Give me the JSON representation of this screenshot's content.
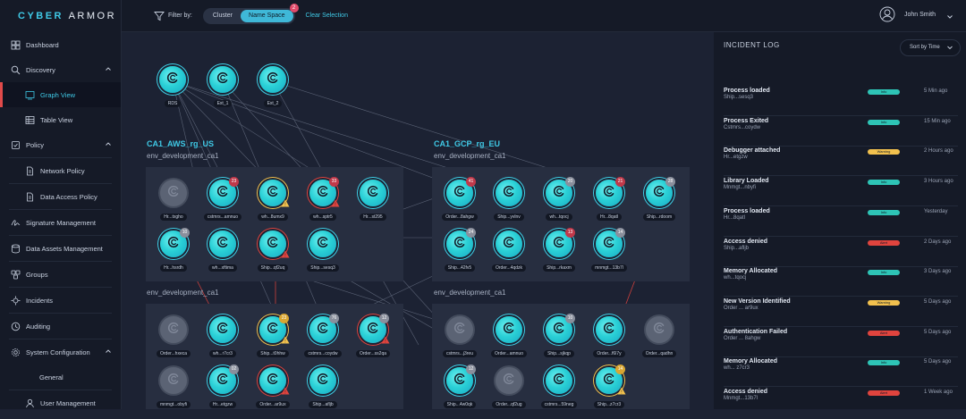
{
  "brand": {
    "cyber": "CYBER",
    "armor": "ARMOR"
  },
  "sidebar": {
    "items": [
      {
        "label": "Dashboard",
        "icon": "dashboard-icon"
      },
      {
        "label": "Discovery",
        "icon": "search-icon"
      },
      {
        "label": "Graph View",
        "icon": "graph-view-icon"
      },
      {
        "label": "Table View",
        "icon": "table-icon"
      },
      {
        "label": "Policy",
        "icon": "policy-icon"
      },
      {
        "label": "Network Policy",
        "icon": "document-icon"
      },
      {
        "label": "Data Access Policy",
        "icon": "document-icon"
      },
      {
        "label": "Signature Management",
        "icon": "signature-icon"
      },
      {
        "label": "Data Assets Management",
        "icon": "database-icon"
      },
      {
        "label": "Groups",
        "icon": "groups-icon"
      },
      {
        "label": "Incidents",
        "icon": "incidents-icon"
      },
      {
        "label": "Auditing",
        "icon": "auditing-icon"
      },
      {
        "label": "System Configuration",
        "icon": "settings-icon"
      },
      {
        "label": "General",
        "icon": ""
      },
      {
        "label": "User Management",
        "icon": "user-icon"
      }
    ]
  },
  "topbar": {
    "filter_label": "Filter by:",
    "options": [
      "Cluster",
      "Name Space"
    ],
    "active_option": "Name Space",
    "badge": "2",
    "clear": "Clear Selection",
    "user": "John Smith"
  },
  "graph": {
    "top_nodes": [
      "RDS",
      "Ext_1",
      "Ext_2"
    ],
    "clusters": [
      {
        "name": "CA1_AWS_rg_US",
        "envs": [
          {
            "name": "env_development_ca1",
            "nodes": [
              {
                "label": "Hr...txgho",
                "count": "",
                "alert": ""
              },
              {
                "label": "cstmrs...amnuo",
                "count": "23",
                "alert": ""
              },
              {
                "label": "wh...8umx9",
                "count": "",
                "alert": "warning"
              },
              {
                "label": "wh...sptr5",
                "count": "33",
                "alert": "alert"
              },
              {
                "label": "Hr...st295",
                "count": "",
                "alert": ""
              },
              {
                "label": "Hr...hsrdh",
                "count": "10",
                "alert": ""
              },
              {
                "label": "wh...xftima",
                "count": "",
                "alert": ""
              },
              {
                "label": "Ship...qf2uq",
                "count": "",
                "alert": "alert"
              },
              {
                "label": "Ship...sesq3",
                "count": "",
                "alert": ""
              }
            ]
          },
          {
            "name": "env_development_ca1",
            "nodes": [
              {
                "label": "Order...hxeca",
                "count": "",
                "alert": ""
              },
              {
                "label": "wh...r7cr3",
                "count": "",
                "alert": ""
              },
              {
                "label": "Ship...t0hhw",
                "count": "23",
                "alert": "warning"
              },
              {
                "label": "cstmrs...coydw",
                "count": "76",
                "alert": ""
              },
              {
                "label": "Order...ss2qa",
                "count": "12",
                "alert": "alert"
              },
              {
                "label": "mnmgt...obyfi",
                "count": "",
                "alert": ""
              },
              {
                "label": "Hr...etgzw",
                "count": "02",
                "alert": ""
              },
              {
                "label": "Order...ar9ux",
                "count": "",
                "alert": "alert"
              },
              {
                "label": "Ship...afljb",
                "count": "",
                "alert": ""
              }
            ]
          }
        ]
      },
      {
        "name": "CA1_GCP_rg_EU",
        "envs": [
          {
            "name": "env_development_ca1",
            "nodes": [
              {
                "label": "Order...8ahgw",
                "count": "41",
                "alert": ""
              },
              {
                "label": "Ship...yvlnv",
                "count": "",
                "alert": ""
              },
              {
                "label": "wh...tqocj",
                "count": "20",
                "alert": ""
              },
              {
                "label": "Hr...8qatl",
                "count": "21",
                "alert": ""
              },
              {
                "label": "Ship...rdoom",
                "count": "28",
                "alert": ""
              },
              {
                "label": "Ship...42fv5",
                "count": "24",
                "alert": ""
              },
              {
                "label": "Order...4qdzk",
                "count": "",
                "alert": ""
              },
              {
                "label": "Ship...rkaxm",
                "count": "13",
                "alert": ""
              },
              {
                "label": "mnmgt...13b7l",
                "count": "14",
                "alert": ""
              }
            ]
          },
          {
            "name": "env_development_ca1",
            "nodes": [
              {
                "label": "cstmrs...j3reu",
                "count": "",
                "alert": ""
              },
              {
                "label": "Order...amnuo",
                "count": "",
                "alert": ""
              },
              {
                "label": "Ship...sjkqp",
                "count": "10",
                "alert": ""
              },
              {
                "label": "Order...f6l7y",
                "count": "",
                "alert": ""
              },
              {
                "label": "Order...qadhn",
                "count": "",
                "alert": ""
              },
              {
                "label": "Ship...4w0qk",
                "count": "12",
                "alert": ""
              },
              {
                "label": "Order...qf2ug",
                "count": "",
                "alert": ""
              },
              {
                "label": "cstmrs...59neg",
                "count": "",
                "alert": ""
              },
              {
                "label": "Ship...z7cr3",
                "count": "14",
                "alert": "warning"
              }
            ]
          }
        ]
      }
    ]
  },
  "incident_log": {
    "title": "INCIDENT LOG",
    "sort_label": "Sort by Time",
    "rows": [
      {
        "title": "Process loaded",
        "sub": "Ship...sesq3",
        "level": "Info",
        "time": "5 Min ago"
      },
      {
        "title": "Process Exited",
        "sub": "Cstmrs...coydw",
        "level": "Info",
        "time": "15 Min ago"
      },
      {
        "title": "Debugger attached",
        "sub": "Hr...etgzw",
        "level": "Warning",
        "time": "2 Hours ago"
      },
      {
        "title": "Library Loaded",
        "sub": "Mnmgt...nbyfi",
        "level": "Info",
        "time": "3 Hours ago"
      },
      {
        "title": "Process loaded",
        "sub": "Hr...8qatl",
        "level": "Info",
        "time": "Yesterday"
      },
      {
        "title": "Access denied",
        "sub": "Ship...afljb",
        "level": "Alert",
        "time": "2 Days ago"
      },
      {
        "title": "Memory Allocated",
        "sub": "wh...tqocj",
        "level": "Info",
        "time": "3 Days ago"
      },
      {
        "title": "New Version Identified",
        "sub": "Order ... ar9ux",
        "level": "Warning",
        "time": "5 Days ago"
      },
      {
        "title": "Authentication Failed",
        "sub": "Order ... 8ahgw",
        "level": "Alert",
        "time": "5 Days ago"
      },
      {
        "title": "Memory Allocated",
        "sub": "wh... z7cr3",
        "level": "Info",
        "time": "5 Days ago"
      },
      {
        "title": "Access denied",
        "sub": "Mnmgt...13b7l",
        "level": "Alert",
        "time": "1 Week ago"
      }
    ]
  },
  "colors": {
    "accent": "#3fc9e6",
    "info": "#2ec4b6",
    "warning": "#f2c14e",
    "alert": "#e0443e"
  }
}
